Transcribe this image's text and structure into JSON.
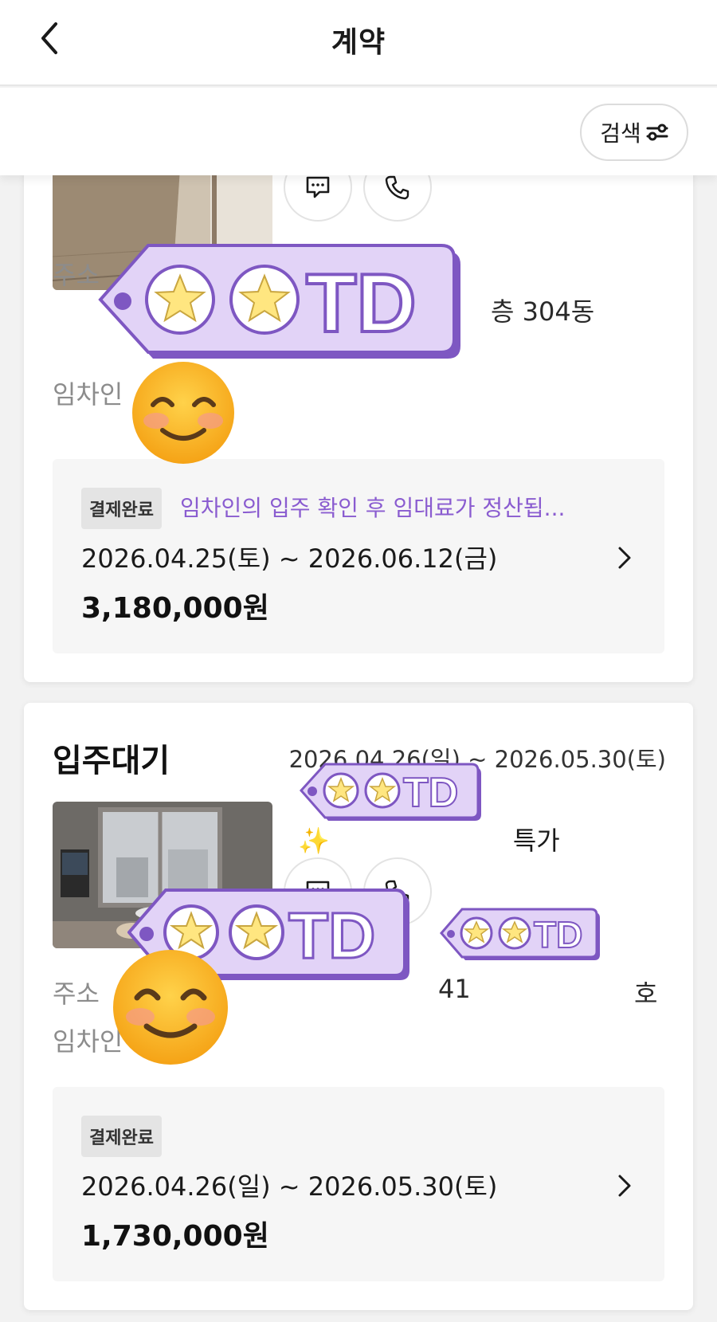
{
  "header": {
    "title": "계약",
    "back_icon": "chevron-left-icon"
  },
  "filter": {
    "search_label": "검색",
    "search_icon": "filter-slider-icon"
  },
  "contracts": [
    {
      "address_label": "주소",
      "address_suffix": "층 304동",
      "tenant_label": "임차인",
      "badge": "결제완료",
      "note": "임차인의 입주 확인 후 임대료가 정산됩...",
      "period": "2026.04.25(토) ~ 2026.06.12(금)",
      "amount": "3,180,000원"
    },
    {
      "status": "입주대기",
      "period_top": "2026.04.26(일) ~ 2026.05.30(토)",
      "listing_title_suffix": "특가",
      "address_label": "주소",
      "address_fragment": "41",
      "address_suffix": "호",
      "tenant_label": "임차인",
      "badge": "결제완료",
      "period": "2026.04.26(일) ~ 2026.05.30(토)",
      "amount": "1,730,000원"
    }
  ],
  "sticker": {
    "text": "TD"
  },
  "colors": {
    "accent_purple": "#8a5cd0",
    "sticker_fill": "#e2d3f7",
    "sticker_border": "#7e57c2",
    "star_fill": "#ffe680"
  }
}
